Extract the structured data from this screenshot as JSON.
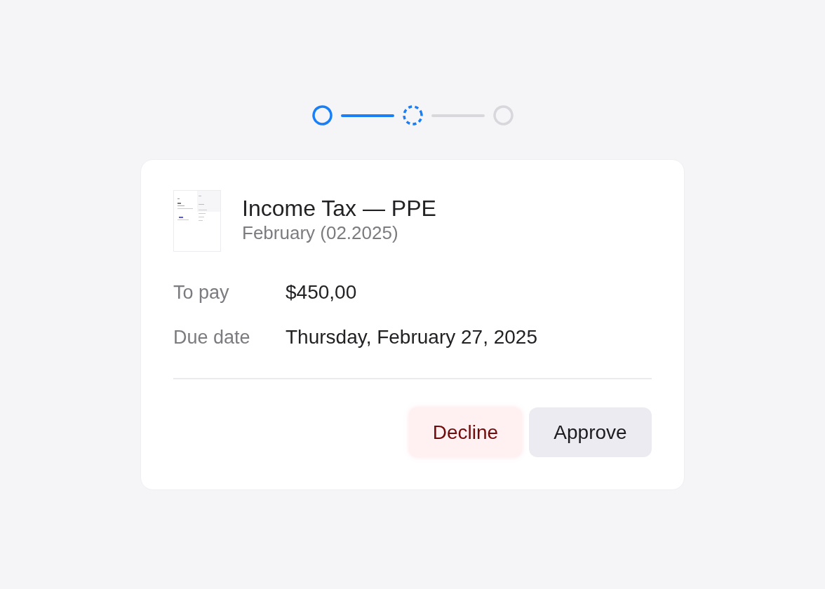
{
  "stepper": {
    "steps": [
      {
        "kind": "complete"
      },
      {
        "kind": "current"
      },
      {
        "kind": "upcoming"
      }
    ]
  },
  "card": {
    "document": {
      "title": "Income Tax — PPE",
      "period": "February (02.2025)"
    },
    "details": [
      {
        "label": "To pay",
        "value": "$450,00"
      },
      {
        "label": "Due date",
        "value": "Thursday, February 27, 2025"
      }
    ],
    "actions": [
      {
        "label": "Decline",
        "kind": "decline"
      },
      {
        "label": "Approve",
        "kind": "approve"
      }
    ]
  }
}
